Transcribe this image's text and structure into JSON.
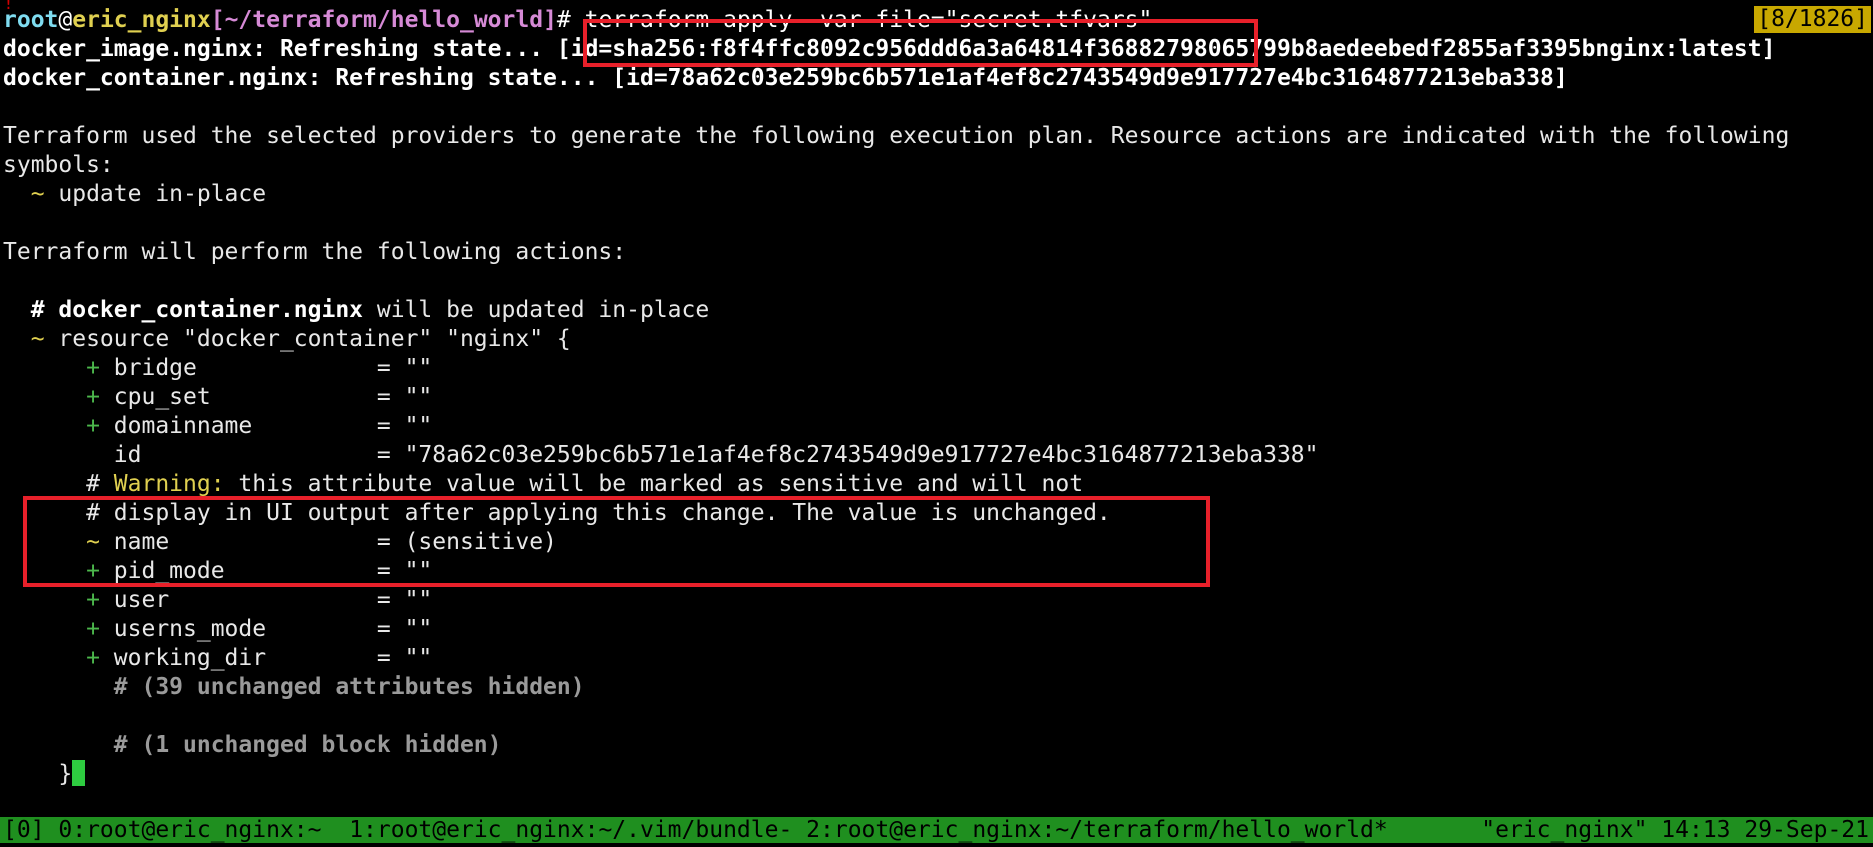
{
  "corner_marker": "!",
  "pane_indicator": "[8/1826]",
  "prompt": {
    "user": "root",
    "at": "@",
    "host": "eric_nginx",
    "path": "[~/terraform/hello_world]",
    "symbol": "#",
    "command": " terraform apply -var-file=\"secret.tfvars\""
  },
  "refresh": {
    "image_line": "docker_image.nginx: Refreshing state... [id=sha256:f8f4ffc8092c956ddd6a3a64814f36882798065799b8aedeebedf2855af3395bnginx:latest]",
    "container_line": "docker_container.nginx: Refreshing state... [id=78a62c03e259bc6b571e1af4ef8c2743549d9e917727e4bc3164877213eba338]"
  },
  "plan_intro": {
    "line1": "Terraform used the selected providers to generate the following execution plan. Resource actions are indicated with the following",
    "line2": "symbols:",
    "symbol_tilde": "  ~",
    "symbol_desc": " update in-place"
  },
  "actions_header": "Terraform will perform the following actions:",
  "resource": {
    "comment_hash": "  # ",
    "comment_name": "docker_container.nginx",
    "comment_suffix": " will be updated in-place",
    "decl_tilde": "  ~",
    "decl_text": " resource \"docker_container\" \"nginx\" {"
  },
  "attributes_before": [
    {
      "marker": "      +",
      "text": " bridge             = \"\""
    },
    {
      "marker": "      +",
      "text": " cpu_set            = \"\""
    },
    {
      "marker": "      +",
      "text": " domainname         = \"\""
    },
    {
      "marker": "       ",
      "text": " id                 = \"78a62c03e259bc6b571e1af4ef8c2743549d9e917727e4bc3164877213eba338\""
    }
  ],
  "warning": {
    "hash1": "      # ",
    "label": "Warning:",
    "text1": " this attribute value will be marked as sensitive and will not",
    "line2": "      # display in UI output after applying this change. The value is unchanged.",
    "name_tilde": "      ~",
    "name_text": " name               = (sensitive)"
  },
  "attributes_after": [
    {
      "marker": "      +",
      "text": " pid_mode           = \"\""
    },
    {
      "marker": "      +",
      "text": " user               = \"\""
    },
    {
      "marker": "      +",
      "text": " userns_mode        = \"\""
    },
    {
      "marker": "      +",
      "text": " working_dir        = \"\""
    }
  ],
  "hidden_attrs": "        # (39 unchanged attributes hidden)",
  "hidden_block": "        # (1 unchanged block hidden)",
  "closing_brace": "    }",
  "status_bar": {
    "session": "[0]",
    "tabs": [
      " 0:root@eric_nginx:~ ",
      " 1:root@eric_nginx:~/.vim/bundle- ",
      "2:root@eric_nginx:~/terraform/hello_world*"
    ],
    "right": "\"eric_nginx\" 14:13 29-Sep-21"
  }
}
